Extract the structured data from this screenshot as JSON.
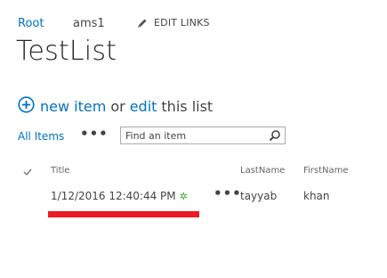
{
  "breadcrumb": {
    "root": "Root",
    "site": "ams1",
    "edit_links": "EDIT LINKS"
  },
  "page_title": "TestList",
  "actions": {
    "new_item": "new item",
    "or": "or",
    "edit": "edit",
    "this_list": "this list"
  },
  "views": {
    "all_items": "All Items",
    "ellipsis": "•••"
  },
  "search": {
    "placeholder": "Find an item"
  },
  "table": {
    "columns": [
      "Title",
      "LastName",
      "FirstName"
    ],
    "rows": [
      {
        "title": "1/12/2016 12:40:44 PM",
        "new_badge": "✲",
        "ellipsis": "•••",
        "last_name": "tayyab",
        "first_name": "khan"
      }
    ]
  },
  "colors": {
    "link": "#0072c6",
    "text": "#444444",
    "highlight": "#ec1c24",
    "new_badge": "#3fa535"
  },
  "icons": {
    "edit_links": "pencil-icon",
    "new_item": "plus-circle-icon",
    "search": "search-icon",
    "header_check": "checkmark-icon"
  }
}
